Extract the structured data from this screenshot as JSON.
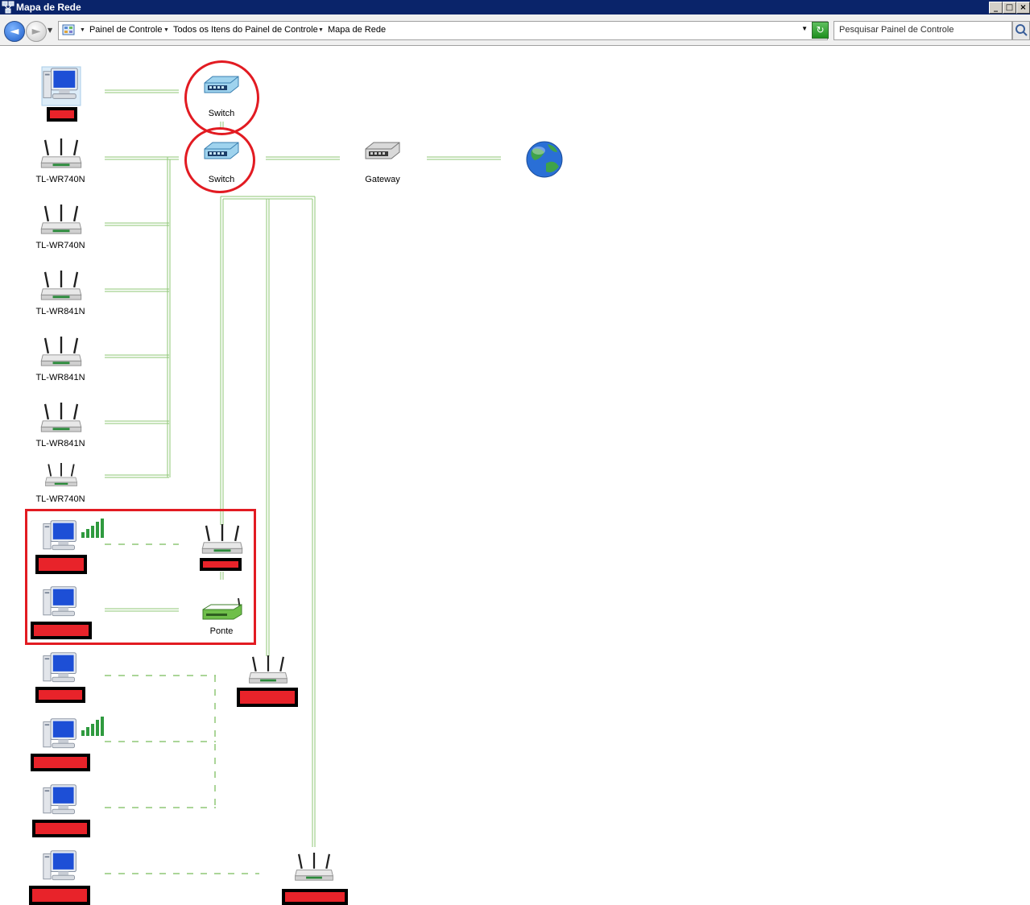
{
  "window": {
    "title": "Mapa de Rede",
    "minimize": "_",
    "maximize": "□",
    "close": "×"
  },
  "navigation": {
    "back_glyph": "◄",
    "forward_glyph": "►",
    "refresh_glyph": "↻",
    "breadcrumb": [
      "Painel de Controle",
      "Todos os Itens do Painel de Controle",
      "Mapa de Rede"
    ],
    "search_placeholder": "Pesquisar Painel de Controle"
  },
  "map": {
    "switch_label": "Switch",
    "gateway_label": "Gateway",
    "bridge_label": "Ponte",
    "routers": [
      "TL-WR740N",
      "TL-WR740N",
      "TL-WR841N",
      "TL-WR841N",
      "TL-WR841N",
      "TL-WR740N"
    ]
  },
  "colors": {
    "link_line": "#8fc776",
    "highlight": "#e21b22",
    "redaction": "#e8232a",
    "titlebar": "#0a246a"
  }
}
